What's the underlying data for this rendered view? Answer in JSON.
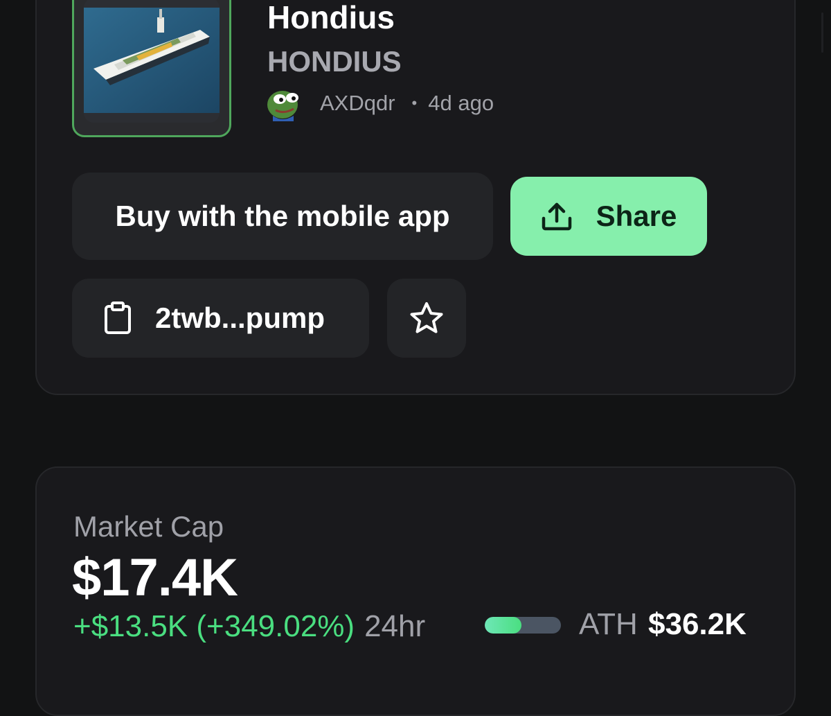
{
  "token": {
    "name": "Hondius",
    "ticker": "HONDIUS",
    "creator": "AXDqdr",
    "separator": "•",
    "age": "4d ago"
  },
  "actions": {
    "buy_label": "Buy with the mobile app",
    "share_label": "Share",
    "contract_short": "2twb...pump"
  },
  "market": {
    "label": "Market Cap",
    "value": "$17.4K",
    "change": "+$13.5K (+349.02%)",
    "period": "24hr",
    "ath_label": "ATH",
    "ath_value": "$36.2K",
    "ath_progress": 0.48
  },
  "icons": {
    "share": "share-upload-icon",
    "clipboard": "clipboard-icon",
    "star": "star-icon",
    "avatar": "pepe-avatar"
  },
  "colors": {
    "accent": "#86efac",
    "positive": "#4ade80",
    "card": "#19191c",
    "border_highlight": "#4fa75c"
  }
}
